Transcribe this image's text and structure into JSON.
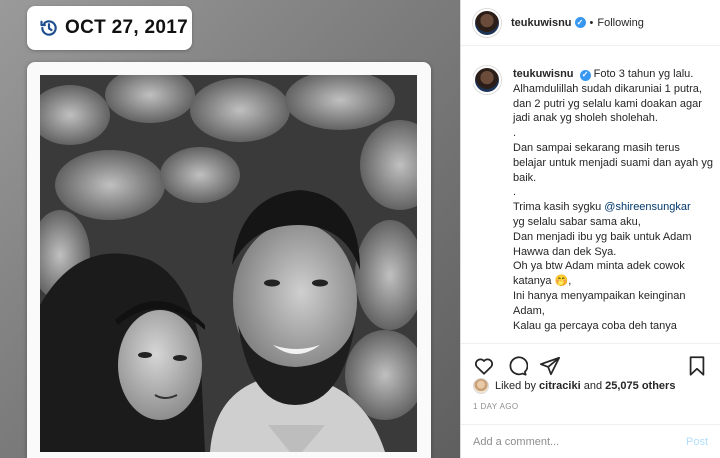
{
  "media": {
    "date_badge": {
      "icon": "history-icon",
      "text": "OCT 27, 2017"
    },
    "photo": {
      "description_icon": "photo-image"
    }
  },
  "header": {
    "username": "teukuwisnu",
    "verified": true,
    "separator": "•",
    "follow_status": "Following"
  },
  "caption": {
    "username": "teukuwisnu",
    "lines": [
      "Foto 3 tahun yg lalu.",
      "Alhamdulillah sudah dikaruniai 1 putra, dan 2 putri yg selalu kami doakan agar jadi anak yg sholeh sholehah.",
      ".",
      "Dan sampai sekarang masih terus belajar untuk menjadi suami dan ayah yg baik.",
      ".",
      "Trima kasih sygku ",
      "yg selalu sabar sama aku,",
      "Dan menjadi ibu yg baik untuk Adam Hawwa dan dek Sya.",
      "Oh ya btw Adam minta adek cowok katanya 🤭,",
      "Ini hanya menyampaikan keinginan Adam,",
      "Kalau ga percaya coba deh tanya"
    ],
    "mention": "@shireensungkar"
  },
  "actions": {
    "like_icon": "heart-icon",
    "comment_icon": "comment-icon",
    "share_icon": "send-icon",
    "save_icon": "bookmark-icon"
  },
  "likes": {
    "prefix": "Liked by",
    "user": "citraciki",
    "conj": "and",
    "count": "25,075 others"
  },
  "timestamp": "1 DAY AGO",
  "comment_box": {
    "placeholder": "Add a comment...",
    "post_label": "Post"
  },
  "colors": {
    "verified": "#3897f0",
    "post_disabled": "#b2dffc",
    "mention": "#00376b"
  }
}
